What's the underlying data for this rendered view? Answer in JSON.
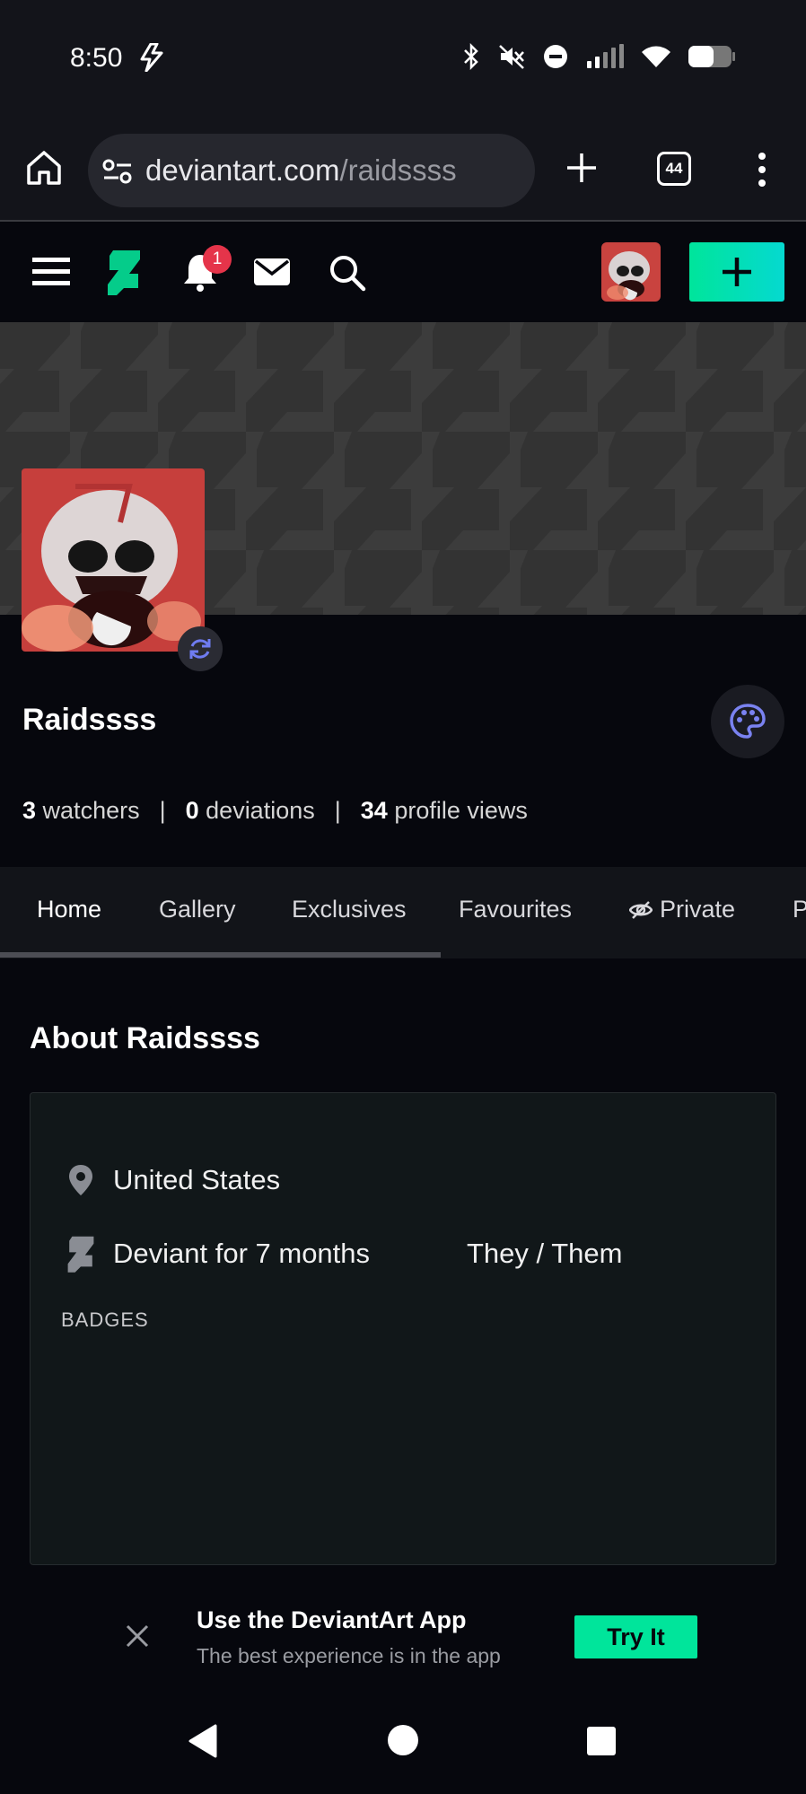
{
  "status_bar": {
    "time": "8:50",
    "icons": [
      "bolt-icon",
      "bluetooth-icon",
      "mute-icon",
      "dnd-icon",
      "signal-icon",
      "wifi-icon",
      "battery-icon"
    ]
  },
  "browser": {
    "url_domain": "deviantart.com",
    "url_path": "/raidssss",
    "tab_count": "44"
  },
  "site_nav": {
    "notification_count": "1",
    "accent": "#05cc8a"
  },
  "profile": {
    "name": "Raidssss",
    "watchers_count": "3",
    "watchers_label": "watchers",
    "deviations_count": "0",
    "deviations_label": "deviations",
    "views_count": "34",
    "views_label": "profile views"
  },
  "tabs": [
    {
      "label": "Home",
      "active": true
    },
    {
      "label": "Gallery"
    },
    {
      "label": "Exclusives"
    },
    {
      "label": "Favourites"
    },
    {
      "label": "Private"
    },
    {
      "label": "P"
    }
  ],
  "about": {
    "title": "About Raidssss",
    "location": "United States",
    "member_since": "Deviant for 7 months",
    "pronouns": "They / Them",
    "badges_label": "BADGES"
  },
  "app_promo": {
    "title": "Use the DeviantArt App",
    "subtitle": "The best experience is in the app",
    "button": "Try It"
  }
}
